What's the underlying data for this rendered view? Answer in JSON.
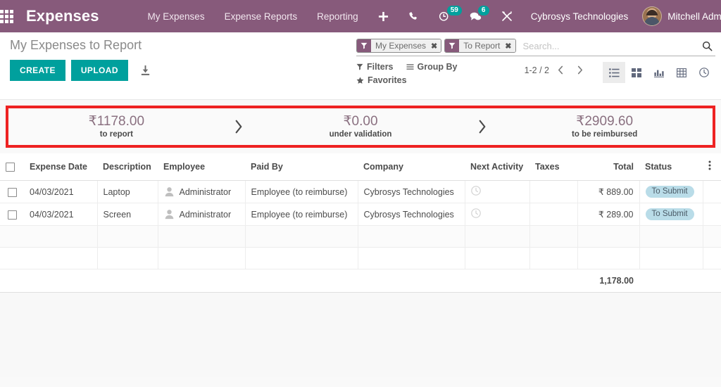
{
  "navbar": {
    "apps_icon": "apps-grid-icon",
    "brand": "Expenses",
    "menu_items": [
      {
        "label": "My Expenses"
      },
      {
        "label": "Expense Reports"
      },
      {
        "label": "Reporting"
      }
    ],
    "icons": [
      {
        "name": "plus-icon",
        "badge": null
      },
      {
        "name": "phone-icon",
        "badge": null
      },
      {
        "name": "clock-activity-icon",
        "badge": "59"
      },
      {
        "name": "chat-messages-icon",
        "badge": "6"
      },
      {
        "name": "tools-wrench-icon",
        "badge": null
      }
    ],
    "company": "Cybrosys Technologies",
    "user": "Mitchell Admin",
    "brand_color": "#875A7B",
    "badge_color": "#00A09D"
  },
  "control_panel": {
    "title": "My Expenses to Report",
    "create_label": "CREATE",
    "upload_label": "UPLOAD",
    "import_icon": "import-download-icon",
    "button_color": "#00A09D"
  },
  "search": {
    "placeholder": "Search...",
    "value": "",
    "facets": [
      {
        "icon": "filter-funnel-icon",
        "label": "My Expenses",
        "close": "✖"
      },
      {
        "icon": "filter-funnel-icon",
        "label": "To Report",
        "close": "✖"
      }
    ],
    "search_icon": "search-magnifier-icon"
  },
  "toolbar": {
    "menus": [
      {
        "icon": "filter-funnel-icon",
        "label": "Filters"
      },
      {
        "icon": "group-by-lines-icon",
        "label": "Group By"
      },
      {
        "icon": "star-favorites-icon",
        "label": "Favorites"
      }
    ],
    "pager": {
      "count": "1-2 / 2",
      "prev_icon": "chevron-left-icon",
      "next_icon": "chevron-right-icon"
    },
    "views": [
      {
        "name": "list-view",
        "icon": "list-view-icon",
        "active": true
      },
      {
        "name": "kanban-view",
        "icon": "kanban-view-icon",
        "active": false
      },
      {
        "name": "graph-view",
        "icon": "graph-bar-view-icon",
        "active": false
      },
      {
        "name": "pivot-view",
        "icon": "pivot-table-view-icon",
        "active": false
      },
      {
        "name": "activity-view",
        "icon": "clock-activity-view-icon",
        "active": false
      }
    ]
  },
  "stats": {
    "highlight_color": "#EE2222",
    "cells": [
      {
        "value": "₹1178.00",
        "label": "to report"
      },
      {
        "value": "₹0.00",
        "label": "under validation"
      },
      {
        "value": "₹2909.60",
        "label": "to be reimbursed"
      }
    ],
    "separator_icon": "chevron-right-icon"
  },
  "table": {
    "columns": [
      "Expense Date",
      "Description",
      "Employee",
      "Paid By",
      "Company",
      "Next Activity",
      "Taxes",
      "Total",
      "Status"
    ],
    "optional_columns_icon": "vertical-dots-icon",
    "select_all_checkbox": "select-all-checkbox",
    "rows": [
      {
        "date": "04/03/2021",
        "description": "Laptop",
        "employee": "Administrator",
        "paid_by": "Employee (to reimburse)",
        "company": "Cybrosys Technologies",
        "next_activity": "",
        "taxes": "",
        "total": "₹ 889.00",
        "status": "To Submit"
      },
      {
        "date": "04/03/2021",
        "description": "Screen",
        "employee": "Administrator",
        "paid_by": "Employee (to reimburse)",
        "company": "Cybrosys Technologies",
        "next_activity": "",
        "taxes": "",
        "total": "₹ 289.00",
        "status": "To Submit"
      }
    ],
    "footer_total": "1,178.00",
    "status_badge_color": "#B9DCE8"
  }
}
